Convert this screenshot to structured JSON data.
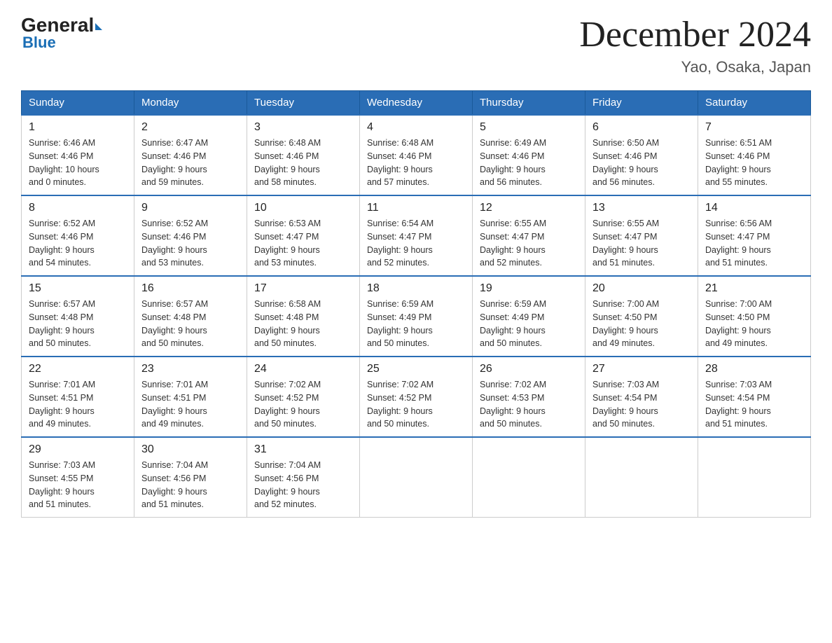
{
  "header": {
    "logo_general": "General",
    "logo_blue": "Blue",
    "calendar_title": "December 2024",
    "subtitle": "Yao, Osaka, Japan"
  },
  "days_of_week": [
    "Sunday",
    "Monday",
    "Tuesday",
    "Wednesday",
    "Thursday",
    "Friday",
    "Saturday"
  ],
  "weeks": [
    [
      {
        "day": "1",
        "sunrise": "6:46 AM",
        "sunset": "4:46 PM",
        "daylight": "10 hours",
        "daylight2": "and 0 minutes."
      },
      {
        "day": "2",
        "sunrise": "6:47 AM",
        "sunset": "4:46 PM",
        "daylight": "9 hours",
        "daylight2": "and 59 minutes."
      },
      {
        "day": "3",
        "sunrise": "6:48 AM",
        "sunset": "4:46 PM",
        "daylight": "9 hours",
        "daylight2": "and 58 minutes."
      },
      {
        "day": "4",
        "sunrise": "6:48 AM",
        "sunset": "4:46 PM",
        "daylight": "9 hours",
        "daylight2": "and 57 minutes."
      },
      {
        "day": "5",
        "sunrise": "6:49 AM",
        "sunset": "4:46 PM",
        "daylight": "9 hours",
        "daylight2": "and 56 minutes."
      },
      {
        "day": "6",
        "sunrise": "6:50 AM",
        "sunset": "4:46 PM",
        "daylight": "9 hours",
        "daylight2": "and 56 minutes."
      },
      {
        "day": "7",
        "sunrise": "6:51 AM",
        "sunset": "4:46 PM",
        "daylight": "9 hours",
        "daylight2": "and 55 minutes."
      }
    ],
    [
      {
        "day": "8",
        "sunrise": "6:52 AM",
        "sunset": "4:46 PM",
        "daylight": "9 hours",
        "daylight2": "and 54 minutes."
      },
      {
        "day": "9",
        "sunrise": "6:52 AM",
        "sunset": "4:46 PM",
        "daylight": "9 hours",
        "daylight2": "and 53 minutes."
      },
      {
        "day": "10",
        "sunrise": "6:53 AM",
        "sunset": "4:47 PM",
        "daylight": "9 hours",
        "daylight2": "and 53 minutes."
      },
      {
        "day": "11",
        "sunrise": "6:54 AM",
        "sunset": "4:47 PM",
        "daylight": "9 hours",
        "daylight2": "and 52 minutes."
      },
      {
        "day": "12",
        "sunrise": "6:55 AM",
        "sunset": "4:47 PM",
        "daylight": "9 hours",
        "daylight2": "and 52 minutes."
      },
      {
        "day": "13",
        "sunrise": "6:55 AM",
        "sunset": "4:47 PM",
        "daylight": "9 hours",
        "daylight2": "and 51 minutes."
      },
      {
        "day": "14",
        "sunrise": "6:56 AM",
        "sunset": "4:47 PM",
        "daylight": "9 hours",
        "daylight2": "and 51 minutes."
      }
    ],
    [
      {
        "day": "15",
        "sunrise": "6:57 AM",
        "sunset": "4:48 PM",
        "daylight": "9 hours",
        "daylight2": "and 50 minutes."
      },
      {
        "day": "16",
        "sunrise": "6:57 AM",
        "sunset": "4:48 PM",
        "daylight": "9 hours",
        "daylight2": "and 50 minutes."
      },
      {
        "day": "17",
        "sunrise": "6:58 AM",
        "sunset": "4:48 PM",
        "daylight": "9 hours",
        "daylight2": "and 50 minutes."
      },
      {
        "day": "18",
        "sunrise": "6:59 AM",
        "sunset": "4:49 PM",
        "daylight": "9 hours",
        "daylight2": "and 50 minutes."
      },
      {
        "day": "19",
        "sunrise": "6:59 AM",
        "sunset": "4:49 PM",
        "daylight": "9 hours",
        "daylight2": "and 50 minutes."
      },
      {
        "day": "20",
        "sunrise": "7:00 AM",
        "sunset": "4:50 PM",
        "daylight": "9 hours",
        "daylight2": "and 49 minutes."
      },
      {
        "day": "21",
        "sunrise": "7:00 AM",
        "sunset": "4:50 PM",
        "daylight": "9 hours",
        "daylight2": "and 49 minutes."
      }
    ],
    [
      {
        "day": "22",
        "sunrise": "7:01 AM",
        "sunset": "4:51 PM",
        "daylight": "9 hours",
        "daylight2": "and 49 minutes."
      },
      {
        "day": "23",
        "sunrise": "7:01 AM",
        "sunset": "4:51 PM",
        "daylight": "9 hours",
        "daylight2": "and 49 minutes."
      },
      {
        "day": "24",
        "sunrise": "7:02 AM",
        "sunset": "4:52 PM",
        "daylight": "9 hours",
        "daylight2": "and 50 minutes."
      },
      {
        "day": "25",
        "sunrise": "7:02 AM",
        "sunset": "4:52 PM",
        "daylight": "9 hours",
        "daylight2": "and 50 minutes."
      },
      {
        "day": "26",
        "sunrise": "7:02 AM",
        "sunset": "4:53 PM",
        "daylight": "9 hours",
        "daylight2": "and 50 minutes."
      },
      {
        "day": "27",
        "sunrise": "7:03 AM",
        "sunset": "4:54 PM",
        "daylight": "9 hours",
        "daylight2": "and 50 minutes."
      },
      {
        "day": "28",
        "sunrise": "7:03 AM",
        "sunset": "4:54 PM",
        "daylight": "9 hours",
        "daylight2": "and 51 minutes."
      }
    ],
    [
      {
        "day": "29",
        "sunrise": "7:03 AM",
        "sunset": "4:55 PM",
        "daylight": "9 hours",
        "daylight2": "and 51 minutes."
      },
      {
        "day": "30",
        "sunrise": "7:04 AM",
        "sunset": "4:56 PM",
        "daylight": "9 hours",
        "daylight2": "and 51 minutes."
      },
      {
        "day": "31",
        "sunrise": "7:04 AM",
        "sunset": "4:56 PM",
        "daylight": "9 hours",
        "daylight2": "and 52 minutes."
      },
      null,
      null,
      null,
      null
    ]
  ],
  "labels": {
    "sunrise_prefix": "Sunrise: ",
    "sunset_prefix": "Sunset: ",
    "daylight_prefix": "Daylight: "
  }
}
